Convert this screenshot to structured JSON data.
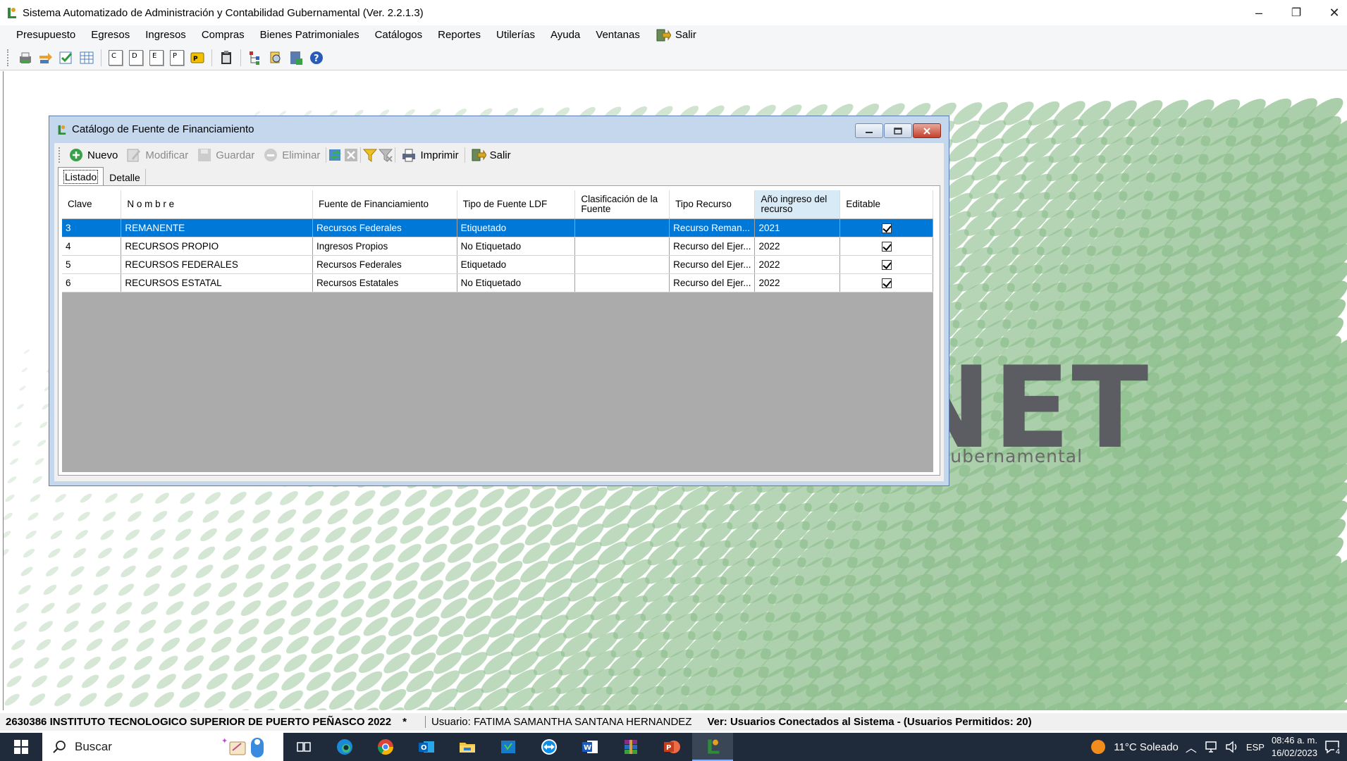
{
  "window": {
    "title": "Sistema Automatizado de Administración y Contabilidad Gubernamental  (Ver. 2.2.1.3)",
    "minimize_glyph": "–",
    "restore_glyph": "❐",
    "close_glyph": "✕"
  },
  "menu": {
    "items": [
      "Presupuesto",
      "Egresos",
      "Ingresos",
      "Compras",
      "Bienes Patrimoniales",
      "Catálogos",
      "Reportes",
      "Utilerías",
      "Ayuda",
      "Ventanas"
    ],
    "salir_label": "Salir"
  },
  "toolbar": {
    "letter_buttons": [
      "C",
      "D",
      "E",
      "P"
    ]
  },
  "background": {
    "logo_text": "NET",
    "logo_subtitle": "lidad Gubernamental"
  },
  "catalog_window": {
    "title": "Catálogo de Fuente de Financiamiento",
    "toolbar": {
      "nuevo": "Nuevo",
      "modificar": "Modificar",
      "guardar": "Guardar",
      "eliminar": "Eliminar",
      "imprimir": "Imprimir",
      "salir": "Salir"
    },
    "tabs": [
      "Listado",
      "Detalle"
    ],
    "active_tab": "Listado",
    "grid": {
      "columns": [
        "Clave",
        "N o m b r e",
        "Fuente de Financiamiento",
        "Tipo de Fuente LDF",
        "Clasificación de la Fuente",
        "Tipo Recurso",
        "Año ingreso del recurso",
        "Editable"
      ],
      "sorted_column": "Año ingreso del recurso",
      "rows": [
        {
          "clave": "3",
          "nombre": "REMANENTE",
          "fuente": "Recursos Federales",
          "tipo_ldf": "Etiquetado",
          "clasificacion": "",
          "tipo_recurso": "Recurso Reman...",
          "anio": "2021",
          "editable": true,
          "selected": true
        },
        {
          "clave": "4",
          "nombre": "RECURSOS PROPIO",
          "fuente": "Ingresos Propios",
          "tipo_ldf": "No Etiquetado",
          "clasificacion": "",
          "tipo_recurso": "Recurso del Ejer...",
          "anio": "2022",
          "editable": true,
          "selected": false
        },
        {
          "clave": "5",
          "nombre": "RECURSOS FEDERALES",
          "fuente": "Recursos Federales",
          "tipo_ldf": "Etiquetado",
          "clasificacion": "",
          "tipo_recurso": "Recurso del Ejer...",
          "anio": "2022",
          "editable": true,
          "selected": false
        },
        {
          "clave": "6",
          "nombre": "RECURSOS ESTATAL",
          "fuente": "Recursos Estatales",
          "tipo_ldf": "No Etiquetado",
          "clasificacion": "",
          "tipo_recurso": "Recurso del Ejer...",
          "anio": "2022",
          "editable": true,
          "selected": false
        }
      ]
    }
  },
  "statusbar": {
    "institution": "2630386 INSTITUTO TECNOLOGICO SUPERIOR DE PUERTO PEÑASCO  2022",
    "modified_flag": "*",
    "user": "Usuario: FATIMA SAMANTHA SANTANA HERNANDEZ",
    "connected": "Ver: Usuarios Conectados al Sistema - (Usuarios Permitidos: 20)"
  },
  "taskbar": {
    "search_placeholder": "Buscar",
    "weather": "11°C  Soleado",
    "language": "ESP",
    "time": "08:46 a. m.",
    "date": "16/02/2023",
    "notification_count": "4"
  },
  "colors": {
    "selection": "#0078d7",
    "mdi_child_frame": "#c4d7ed",
    "taskbar": "#1f2a3a",
    "green_dots": "#8fbf8f"
  }
}
